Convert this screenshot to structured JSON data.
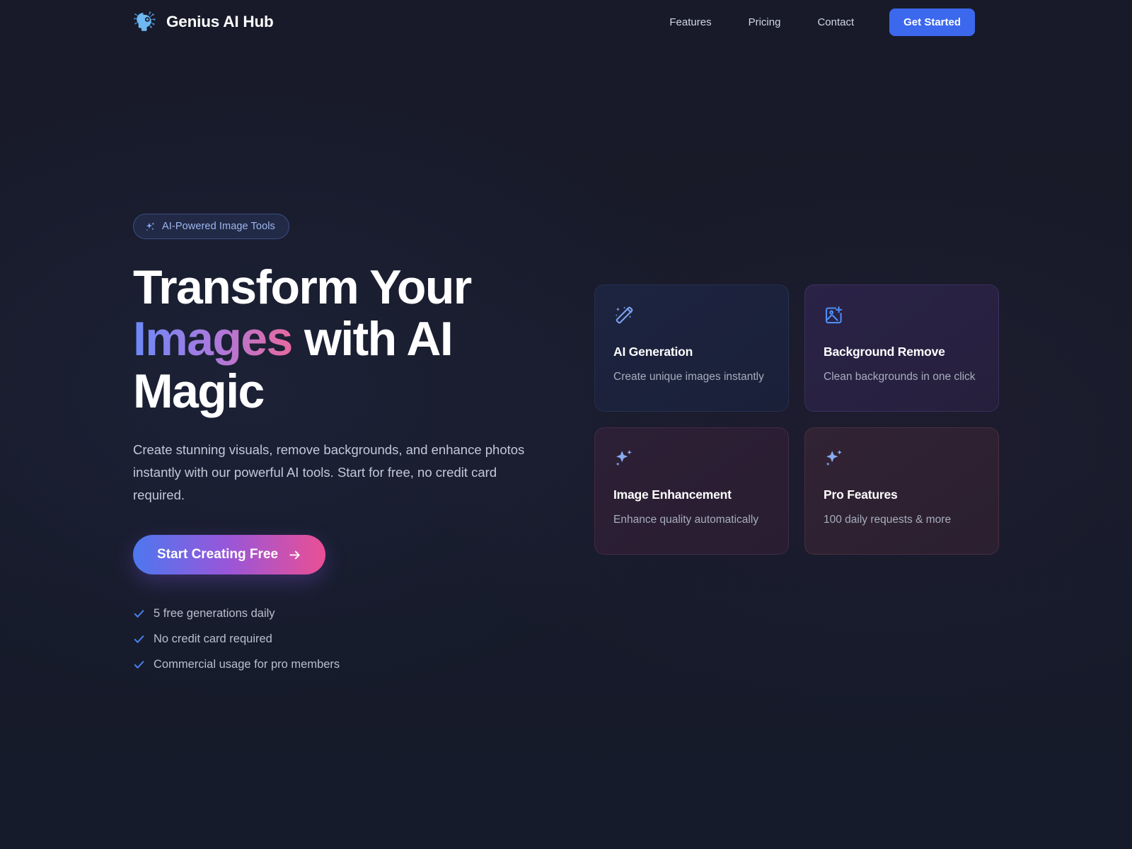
{
  "header": {
    "brand": {
      "name": "Genius AI Hub",
      "icon": "ai-brain-head-icon"
    },
    "nav": [
      {
        "label": "Features",
        "name": "nav-link-features"
      },
      {
        "label": "Pricing",
        "name": "nav-link-pricing"
      },
      {
        "label": "Contact",
        "name": "nav-link-contact"
      }
    ],
    "cta": {
      "label": "Get Started",
      "color": "#3b68ed"
    }
  },
  "hero": {
    "badge": {
      "icon": "sparkles-icon",
      "text": "AI-Powered Image Tools"
    },
    "headline": {
      "line1": "Transform Your",
      "highlight": "Images",
      "line2_rest": " with AI",
      "line3": "Magic",
      "gradient_from": "#6b8af7",
      "gradient_mid": "#a77ae0",
      "gradient_to": "#e8699f"
    },
    "subcopy": "Create stunning visuals, remove backgrounds, and enhance photos instantly with our powerful AI tools. Start for free, no credit card required.",
    "cta": {
      "label": "Start Creating Free",
      "icon": "arrow-right-icon"
    },
    "checklist": [
      {
        "label": "5 free generations daily",
        "icon": "check-icon"
      },
      {
        "label": "No credit card required",
        "icon": "check-icon"
      },
      {
        "label": "Commercial usage for pro members",
        "icon": "check-icon"
      }
    ]
  },
  "features": [
    {
      "title": "AI Generation",
      "desc": "Create unique images instantly",
      "icon": "magic-wand-icon",
      "accent": "#7ba2f0"
    },
    {
      "title": "Background Remove",
      "desc": "Clean backgrounds in one click",
      "icon": "image-plus-icon",
      "accent": "#4f8df5"
    },
    {
      "title": "Image Enhancement",
      "desc": "Enhance quality automatically",
      "icon": "sparkles-icon",
      "accent": "#8aabf2"
    },
    {
      "title": "Pro Features",
      "desc": "100 daily requests & more",
      "icon": "sparkles-icon",
      "accent": "#8aabf2"
    }
  ]
}
